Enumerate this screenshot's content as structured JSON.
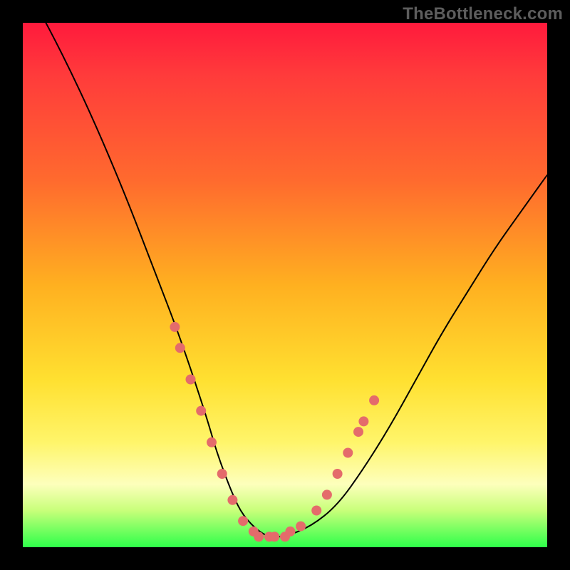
{
  "watermark": {
    "text": "TheBottleneck.com"
  },
  "colors": {
    "background": "#000000",
    "curve_stroke": "#000000",
    "dot_fill": "#e46b6b",
    "gradient_stops": [
      "#ff1a3c",
      "#ff3b3b",
      "#ff6a2e",
      "#ffb020",
      "#ffe030",
      "#fff56a",
      "#fdffbc",
      "#c8ff7a",
      "#2eff4a"
    ]
  },
  "chart_data": {
    "type": "line",
    "title": "",
    "xlabel": "",
    "ylabel": "",
    "xlim": [
      0,
      100
    ],
    "ylim": [
      0,
      100
    ],
    "x": [
      0,
      5,
      10,
      15,
      20,
      25,
      30,
      35,
      37,
      40,
      42,
      45,
      47,
      50,
      55,
      60,
      65,
      70,
      75,
      80,
      85,
      90,
      95,
      100
    ],
    "values": [
      108,
      99,
      89,
      78,
      66,
      53,
      40,
      25,
      18,
      10,
      6,
      3,
      2,
      2,
      4,
      8,
      15,
      23,
      32,
      41,
      49,
      57,
      64,
      71
    ],
    "note": "values read visually as percentage of plot height from bottom (0=bottom, 100=top); curve is an asymmetric V with minimum roughly at x≈46, left arm steeper than right.",
    "dots_left": [
      {
        "x": 29,
        "y": 42
      },
      {
        "x": 30,
        "y": 38
      },
      {
        "x": 32,
        "y": 32
      },
      {
        "x": 34,
        "y": 26
      },
      {
        "x": 36,
        "y": 20
      },
      {
        "x": 38,
        "y": 14
      },
      {
        "x": 40,
        "y": 9
      },
      {
        "x": 42,
        "y": 5
      }
    ],
    "dots_bottom": [
      {
        "x": 44,
        "y": 3
      },
      {
        "x": 45,
        "y": 2
      },
      {
        "x": 47,
        "y": 2
      },
      {
        "x": 48,
        "y": 2
      },
      {
        "x": 50,
        "y": 2
      },
      {
        "x": 51,
        "y": 3
      },
      {
        "x": 53,
        "y": 4
      }
    ],
    "dots_right": [
      {
        "x": 56,
        "y": 7
      },
      {
        "x": 58,
        "y": 10
      },
      {
        "x": 60,
        "y": 14
      },
      {
        "x": 62,
        "y": 18
      },
      {
        "x": 64,
        "y": 22
      },
      {
        "x": 65,
        "y": 24
      },
      {
        "x": 67,
        "y": 28
      }
    ],
    "dot_radius": 7
  }
}
